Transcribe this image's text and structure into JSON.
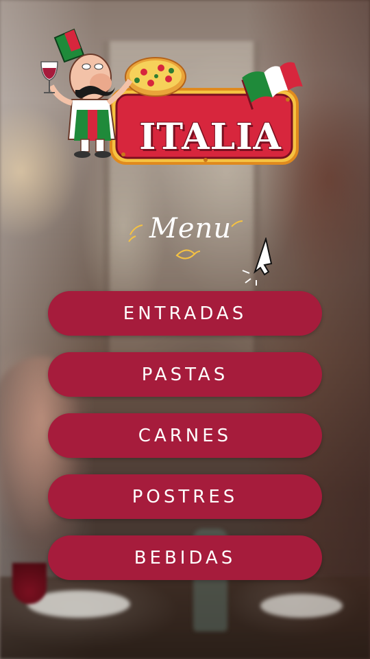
{
  "logo": {
    "title": "ITALIA",
    "icons": [
      "chef-mascot-icon",
      "pizza-icon",
      "italian-flag-icon",
      "wine-glass-icon"
    ]
  },
  "menu_heading": "Menu",
  "pointer_icon": "cursor-arrow-icon",
  "menu_items": [
    {
      "label": "ENTRADAS"
    },
    {
      "label": "PASTAS"
    },
    {
      "label": "CARNES"
    },
    {
      "label": "POSTRES"
    },
    {
      "label": "BEBIDAS"
    }
  ],
  "colors": {
    "button": "#a61c3c",
    "button_text": "#ffffff",
    "logo_red": "#d7263d",
    "logo_yellow": "#f5c242",
    "flag_green": "#1f8a3a"
  }
}
